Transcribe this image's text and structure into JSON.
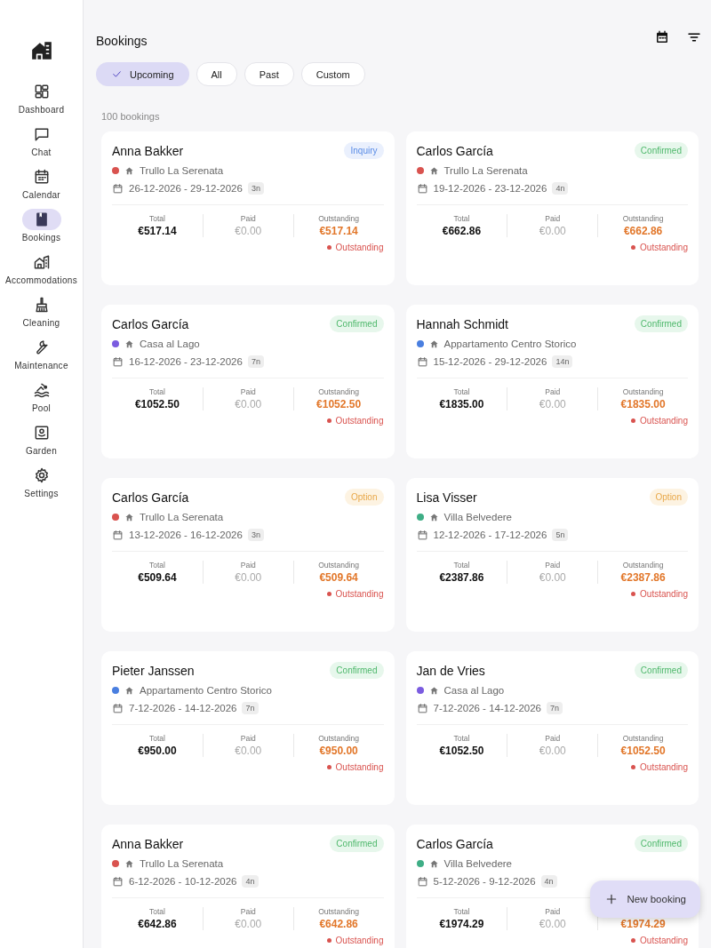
{
  "sidebar": {
    "items": [
      {
        "label": "Dashboard",
        "selected": false
      },
      {
        "label": "Chat",
        "selected": false
      },
      {
        "label": "Calendar",
        "selected": false
      },
      {
        "label": "Bookings",
        "selected": true
      },
      {
        "label": "Accommodations",
        "selected": false
      },
      {
        "label": "Cleaning",
        "selected": false
      },
      {
        "label": "Maintenance",
        "selected": false
      },
      {
        "label": "Pool",
        "selected": false
      },
      {
        "label": "Garden",
        "selected": false
      },
      {
        "label": "Settings",
        "selected": false
      }
    ]
  },
  "header": {
    "title": "Bookings"
  },
  "filters": [
    {
      "label": "Upcoming",
      "selected": true
    },
    {
      "label": "All",
      "selected": false
    },
    {
      "label": "Past",
      "selected": false
    },
    {
      "label": "Custom",
      "selected": false
    }
  ],
  "count": "100 bookings",
  "bookings": [
    {
      "guest": "Anna Bakker",
      "status": "Inquiry",
      "kind": "inquiry",
      "property": "Trullo La Serenata",
      "color": "#d9534f",
      "dates": "26-12-2026 - 29-12-2026",
      "nights": "3n",
      "total_label": "Total",
      "total": "€517.14",
      "paid_label": "Paid",
      "paid": "€0.00",
      "outstanding_label": "Outstanding",
      "outstanding": "€517.14",
      "payment_state": "Outstanding"
    },
    {
      "guest": "Carlos García",
      "status": "Confirmed",
      "kind": "confirmed",
      "property": "Trullo La Serenata",
      "color": "#d9534f",
      "dates": "19-12-2026 - 23-12-2026",
      "nights": "4n",
      "total_label": "Total",
      "total": "€662.86",
      "paid_label": "Paid",
      "paid": "€0.00",
      "outstanding_label": "Outstanding",
      "outstanding": "€662.86",
      "payment_state": "Outstanding"
    },
    {
      "guest": "Carlos García",
      "status": "Confirmed",
      "kind": "confirmed",
      "property": "Casa al Lago",
      "color": "#7b5ce0",
      "dates": "16-12-2026 - 23-12-2026",
      "nights": "7n",
      "total_label": "Total",
      "total": "€1052.50",
      "paid_label": "Paid",
      "paid": "€0.00",
      "outstanding_label": "Outstanding",
      "outstanding": "€1052.50",
      "payment_state": "Outstanding"
    },
    {
      "guest": "Hannah Schmidt",
      "status": "Confirmed",
      "kind": "confirmed",
      "property": "Appartamento Centro Storico",
      "color": "#4a7fe0",
      "dates": "15-12-2026 - 29-12-2026",
      "nights": "14n",
      "total_label": "Total",
      "total": "€1835.00",
      "paid_label": "Paid",
      "paid": "€0.00",
      "outstanding_label": "Outstanding",
      "outstanding": "€1835.00",
      "payment_state": "Outstanding"
    },
    {
      "guest": "Carlos García",
      "status": "Option",
      "kind": "option",
      "property": "Trullo La Serenata",
      "color": "#d9534f",
      "dates": "13-12-2026 - 16-12-2026",
      "nights": "3n",
      "total_label": "Total",
      "total": "€509.64",
      "paid_label": "Paid",
      "paid": "€0.00",
      "outstanding_label": "Outstanding",
      "outstanding": "€509.64",
      "payment_state": "Outstanding"
    },
    {
      "guest": "Lisa Visser",
      "status": "Option",
      "kind": "option",
      "property": "Villa Belvedere",
      "color": "#3fae86",
      "dates": "12-12-2026 - 17-12-2026",
      "nights": "5n",
      "total_label": "Total",
      "total": "€2387.86",
      "paid_label": "Paid",
      "paid": "€0.00",
      "outstanding_label": "Outstanding",
      "outstanding": "€2387.86",
      "payment_state": "Outstanding"
    },
    {
      "guest": "Pieter Janssen",
      "status": "Confirmed",
      "kind": "confirmed",
      "property": "Appartamento Centro Storico",
      "color": "#4a7fe0",
      "dates": "7-12-2026 - 14-12-2026",
      "nights": "7n",
      "total_label": "Total",
      "total": "€950.00",
      "paid_label": "Paid",
      "paid": "€0.00",
      "outstanding_label": "Outstanding",
      "outstanding": "€950.00",
      "payment_state": "Outstanding"
    },
    {
      "guest": "Jan de Vries",
      "status": "Confirmed",
      "kind": "confirmed",
      "property": "Casa al Lago",
      "color": "#7b5ce0",
      "dates": "7-12-2026 - 14-12-2026",
      "nights": "7n",
      "total_label": "Total",
      "total": "€1052.50",
      "paid_label": "Paid",
      "paid": "€0.00",
      "outstanding_label": "Outstanding",
      "outstanding": "€1052.50",
      "payment_state": "Outstanding"
    },
    {
      "guest": "Anna Bakker",
      "status": "Confirmed",
      "kind": "confirmed",
      "property": "Trullo La Serenata",
      "color": "#d9534f",
      "dates": "6-12-2026 - 10-12-2026",
      "nights": "4n",
      "total_label": "Total",
      "total": "€642.86",
      "paid_label": "Paid",
      "paid": "€0.00",
      "outstanding_label": "Outstanding",
      "outstanding": "€642.86",
      "payment_state": "Outstanding"
    },
    {
      "guest": "Carlos García",
      "status": "Confirmed",
      "kind": "confirmed",
      "property": "Villa Belvedere",
      "color": "#3fae86",
      "dates": "5-12-2026 - 9-12-2026",
      "nights": "4n",
      "total_label": "Total",
      "total": "€1974.29",
      "paid_label": "Paid",
      "paid": "€0.00",
      "outstanding": "€1974.29",
      "payment_state": "Outstanding"
    }
  ],
  "fab": {
    "label": "New booking"
  }
}
